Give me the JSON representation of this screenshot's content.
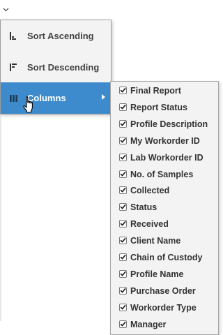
{
  "menu": {
    "sort_ascending": "Sort Ascending",
    "sort_descending": "Sort Descending",
    "columns": "Columns"
  },
  "columns_submenu": {
    "items": [
      {
        "label": "Final Report",
        "checked": true
      },
      {
        "label": "Report Status",
        "checked": true
      },
      {
        "label": "Profile Description",
        "checked": true
      },
      {
        "label": "My Workorder ID",
        "checked": true
      },
      {
        "label": "Lab Workorder ID",
        "checked": true
      },
      {
        "label": "No. of Samples",
        "checked": true
      },
      {
        "label": "Collected",
        "checked": true
      },
      {
        "label": "Status",
        "checked": true
      },
      {
        "label": "Received",
        "checked": true
      },
      {
        "label": "Client Name",
        "checked": true
      },
      {
        "label": "Chain of Custody",
        "checked": true
      },
      {
        "label": "Profile Name",
        "checked": true
      },
      {
        "label": "Purchase Order",
        "checked": true
      },
      {
        "label": "Workorder Type",
        "checked": true
      },
      {
        "label": "Manager",
        "checked": true
      }
    ]
  },
  "colors": {
    "highlight": "#3d8bcc",
    "menu_bg": "#f3f3f3",
    "text": "#333333"
  }
}
